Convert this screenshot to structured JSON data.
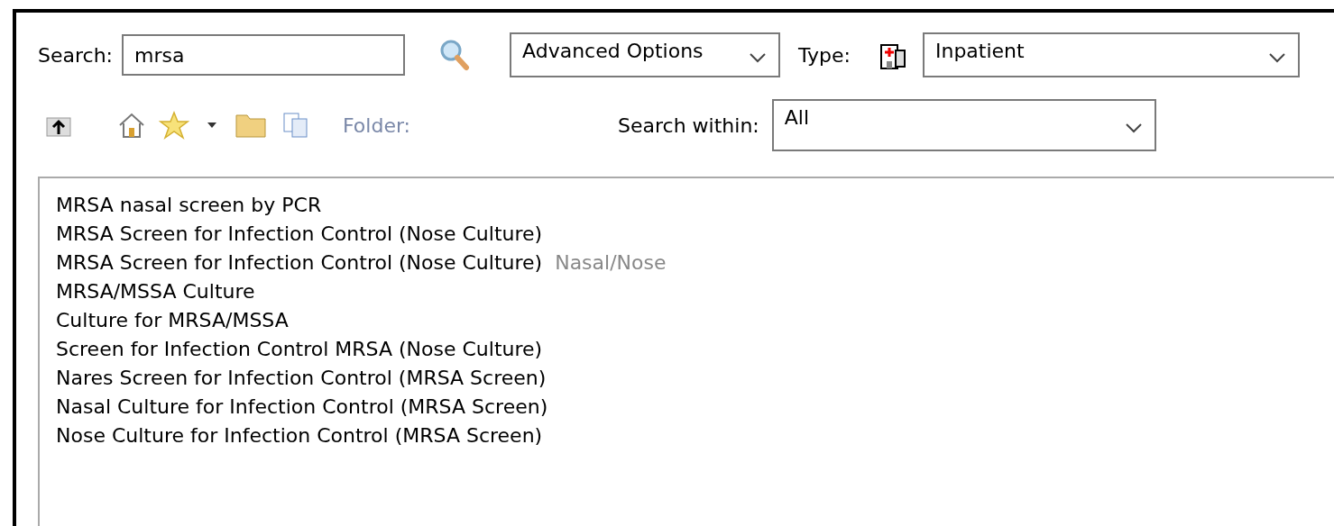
{
  "search": {
    "label": "Search:",
    "value": "mrsa"
  },
  "advanced_options": {
    "value": "Advanced Options"
  },
  "type": {
    "label": "Type:",
    "value": "Inpatient"
  },
  "toolbar": {
    "folder_label": "Folder:"
  },
  "search_within": {
    "label": "Search within:",
    "value": "All"
  },
  "results": [
    {
      "name": "MRSA nasal screen by PCR"
    },
    {
      "name": "MRSA Screen for Infection Control (Nose Culture)"
    },
    {
      "name": "MRSA Screen for Infection Control (Nose Culture)",
      "detail": "Nasal/Nose"
    },
    {
      "name": "MRSA/MSSA Culture"
    },
    {
      "name": "Culture for MRSA/MSSA"
    },
    {
      "name": "Screen for Infection Control MRSA (Nose Culture)"
    },
    {
      "name": "Nares Screen for Infection Control (MRSA Screen)"
    },
    {
      "name": "Nasal Culture for Infection Control (MRSA Screen)"
    },
    {
      "name": "Nose Culture for Infection Control (MRSA Screen)"
    }
  ]
}
